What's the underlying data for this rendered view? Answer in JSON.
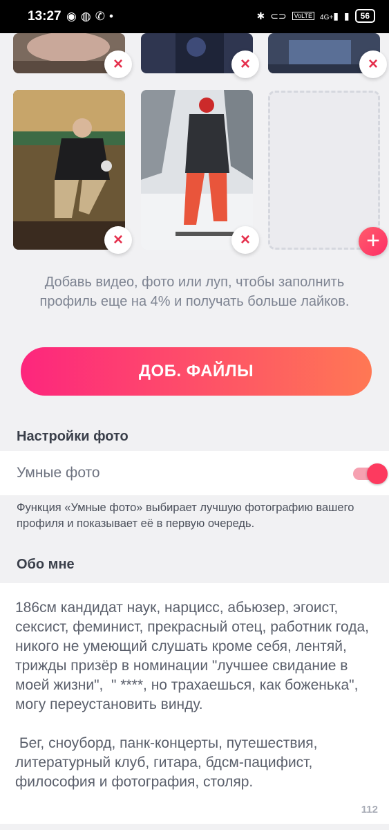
{
  "status_bar": {
    "time": "13:27",
    "left_icons": [
      "ring-icon",
      "incognito-icon",
      "whatsapp-icon",
      "dot-icon"
    ],
    "right_icons": [
      "bluetooth-icon",
      "toggle-icon",
      "volte-icon",
      "signal-4g-icon",
      "signal-icon"
    ],
    "volte": "VoLTE",
    "network": "4G+",
    "battery": "56"
  },
  "media": {
    "photos_top": [
      "photo-1",
      "photo-2",
      "photo-3"
    ],
    "photos_bottom": [
      "photo-4",
      "photo-5"
    ],
    "remove_icon": "×",
    "add_icon": "+",
    "hint": "Добавь видео, фото или луп, чтобы заполнить профиль еще на 4% и получать больше лайков.",
    "add_files_label": "ДОБ. ФАЙЛЫ"
  },
  "photo_settings": {
    "title": "Настройки фото",
    "smart_photos_label": "Умные фото",
    "smart_photos_on": true,
    "description": "Функция «Умные фото» выбирает лучшую фотографию вашего профиля и показывает её в первую очередь."
  },
  "about": {
    "title": "Обо мне",
    "text": "186см кандидат наук, нарцисс, абьюзер, эгоист, сексист, феминист, прекрасный отец, работник года, никого не умеющий слушать кроме себя, лентяй, трижды призёр в номинации \"лучшее свидание в моей жизни\",  \" ****, но трахаешься, как боженька\", могу переустановить винду.\n\n Бег, сноуборд, панк-концерты, путешествия, литературный клуб, гитара, бдсм-пацифист, философия и фотография, столяр.",
    "counter": "112"
  },
  "colors": {
    "accent": "#fd2f66",
    "gradient_start": "#fd267d",
    "gradient_end": "#ff7854",
    "remove": "#e5304d"
  }
}
